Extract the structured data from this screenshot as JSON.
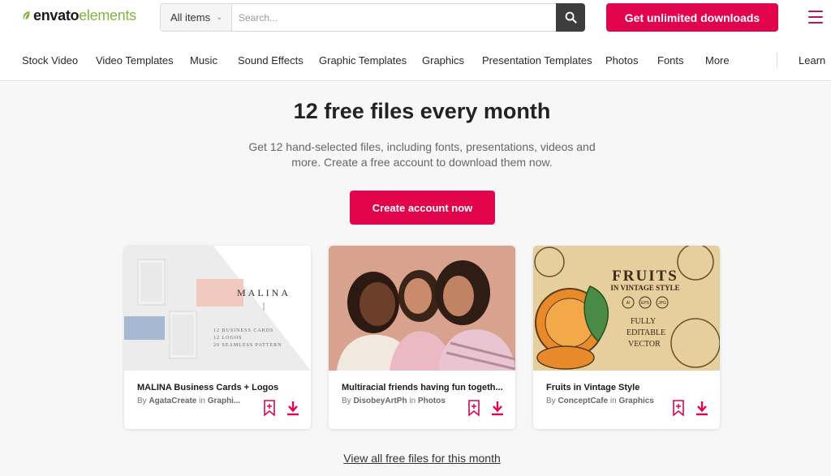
{
  "header": {
    "logo_part1": "envato",
    "logo_part2": "elements",
    "search_category": "All items",
    "search_placeholder": "Search...",
    "cta_label": "Get unlimited downloads",
    "brand_color": "#e2034d",
    "logo_green": "#82b541"
  },
  "nav": {
    "items": [
      "Stock Video",
      "Video Templates",
      "Music",
      "Sound Effects",
      "Graphic Templates",
      "Graphics",
      "Presentation Templates",
      "Photos",
      "Fonts",
      "More"
    ],
    "learn": "Learn"
  },
  "hero": {
    "title": "12 free files every month",
    "subtitle": "Get 12 hand-selected files, including fonts, presentations, videos and more. Create a free account to download them now.",
    "button": "Create account now"
  },
  "cards": [
    {
      "title": "MALINA Business Cards + Logos",
      "by": "By",
      "author": "AgataCreate",
      "in": "in",
      "category": "Graphi...",
      "thumb_text": {
        "brand": "MALINA",
        "line1": "12 BUSINESS CARDS",
        "line2": "12 LOGOS",
        "line3": "20 SEAMLESS PATTERN"
      }
    },
    {
      "title": "Multiracial friends having fun togeth...",
      "by": "By",
      "author": "DisobeyArtPh",
      "in": "in",
      "category": "Photos"
    },
    {
      "title": "Fruits in Vintage Style",
      "by": "By",
      "author": "ConceptCafe",
      "in": "in",
      "category": "Graphics",
      "thumb_text": {
        "h1": "FRUITS",
        "h2": "IN VINTAGE STYLE",
        "b1": "AI",
        "b2": "EPS",
        "b3": "JPG",
        "f1": "FULLY",
        "f2": "EDITABLE",
        "f3": "VECTOR"
      }
    }
  ],
  "footer_link": "View all free files for this month"
}
